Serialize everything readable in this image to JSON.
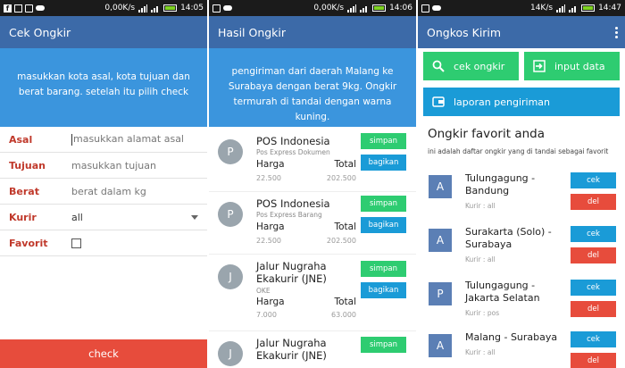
{
  "screen1": {
    "status": {
      "speed": "0,00K/s",
      "time": "14:05"
    },
    "appbar_title": "Cek Ongkir",
    "banner_text": "masukkan kota asal, kota tujuan dan berat barang. setelah itu pilih",
    "banner_emph": "check",
    "form": {
      "asal_label": "Asal",
      "asal_placeholder": "masukkan alamat asal",
      "tujuan_label": "Tujuan",
      "tujuan_placeholder": "masukkan tujuan",
      "berat_label": "Berat",
      "berat_placeholder": "berat dalam kg",
      "kurir_label": "Kurir",
      "kurir_value": "all",
      "favorit_label": "Favorit"
    },
    "check_button": "check"
  },
  "screen2": {
    "status": {
      "speed": "0,00K/s",
      "time": "14:06"
    },
    "appbar_title": "Hasil Ongkir",
    "banner_text": "pengiriman dari daerah Malang ke Surabaya dengan berat 9kg. Ongkir termurah di tandai dengan warna kuning.",
    "harga_label": "Harga",
    "total_label": "Total",
    "simpan_label": "simpan",
    "bagikan_label": "bagikan",
    "results": [
      {
        "initial": "P",
        "name": "POS Indonesia",
        "service": "Pos Express Dokumen",
        "harga": "22.500",
        "total": "202.500"
      },
      {
        "initial": "P",
        "name": "POS Indonesia",
        "service": "Pos Express Barang",
        "harga": "22.500",
        "total": "202.500"
      },
      {
        "initial": "J",
        "name": "Jalur Nugraha Ekakurir (JNE)",
        "service": "OKE",
        "harga": "7.000",
        "total": "63.000"
      },
      {
        "initial": "J",
        "name": "Jalur Nugraha Ekakurir (JNE)",
        "service": "",
        "harga": "",
        "total": ""
      }
    ]
  },
  "screen3": {
    "status": {
      "speed": "14K/s",
      "time": "14:47"
    },
    "appbar_title": "Ongkos Kirim",
    "buttons": {
      "cek_ongkir": "cek ongkir",
      "input_data": "input data",
      "laporan": "laporan pengiriman"
    },
    "fav_title": "Ongkir favorit anda",
    "fav_desc": "ini adalah daftar ongkir yang di tandai sebagai favorit",
    "cek_label": "cek",
    "del_label": "del",
    "favorites": [
      {
        "initial": "A",
        "route": "Tulungagung - Bandung",
        "kurir": "Kurir : all"
      },
      {
        "initial": "A",
        "route": "Surakarta (Solo) - Surabaya",
        "kurir": "Kurir : all"
      },
      {
        "initial": "P",
        "route": "Tulungagung - Jakarta Selatan",
        "kurir": "Kurir : pos"
      },
      {
        "initial": "A",
        "route": "Malang - Surabaya",
        "kurir": "Kurir : all"
      }
    ],
    "colors": {
      "green": "#2ecc71",
      "blue": "#1a9bd7",
      "red": "#e74c3c"
    }
  }
}
